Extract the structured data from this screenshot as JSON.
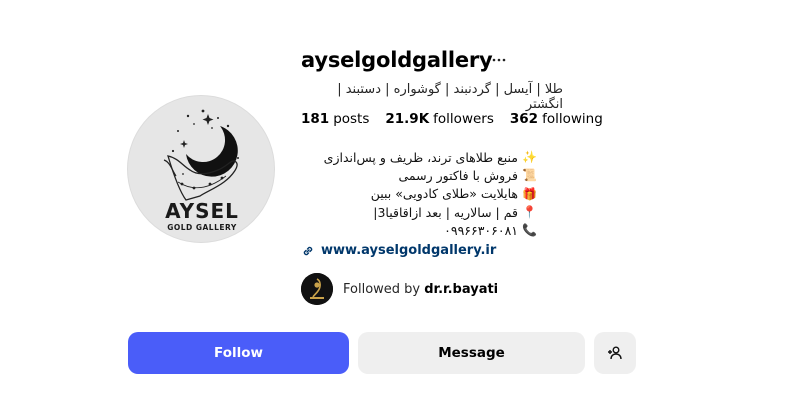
{
  "profile": {
    "username": "ayselgoldgallery",
    "more_icon": "ellipsis-icon",
    "category": "طلا | آیسل | گردنبند | گوشواره | دستبند | انگشتر",
    "avatar_brand": "AYSEL",
    "avatar_sub": "GOLD GALLERY"
  },
  "stats": {
    "posts_value": "181",
    "posts_label": "posts",
    "followers_value": "21.9K",
    "followers_label": "followers",
    "following_value": "362",
    "following_label": "following"
  },
  "bio": {
    "line1": "منبع طلاهای ترند، ظریف و پس‌اندازی",
    "line1_emoji": "✨",
    "line2": "فروش با فاکتور رسمی",
    "line2_emoji": "📜",
    "line3": "هایلایت «طلای کادویی» ببین",
    "line3_emoji": "🎁",
    "line4": "قم | سالاریه | بعد ازاقاقیا3|",
    "line4_emoji": "📍",
    "line5": "۰۹۹۶۶۳۰۶۰۸۱",
    "line5_emoji": "📞"
  },
  "link": {
    "text": "www.ayselgoldgallery.ir",
    "icon": "link-icon"
  },
  "followed_by": {
    "prefix": "Followed by",
    "user": "dr.r.bayati"
  },
  "actions": {
    "follow_label": "Follow",
    "message_label": "Message",
    "add_user_icon": "add-user-icon"
  },
  "colors": {
    "accent": "#4a5df9",
    "secondary_button": "#efefef",
    "link": "#00376b"
  }
}
